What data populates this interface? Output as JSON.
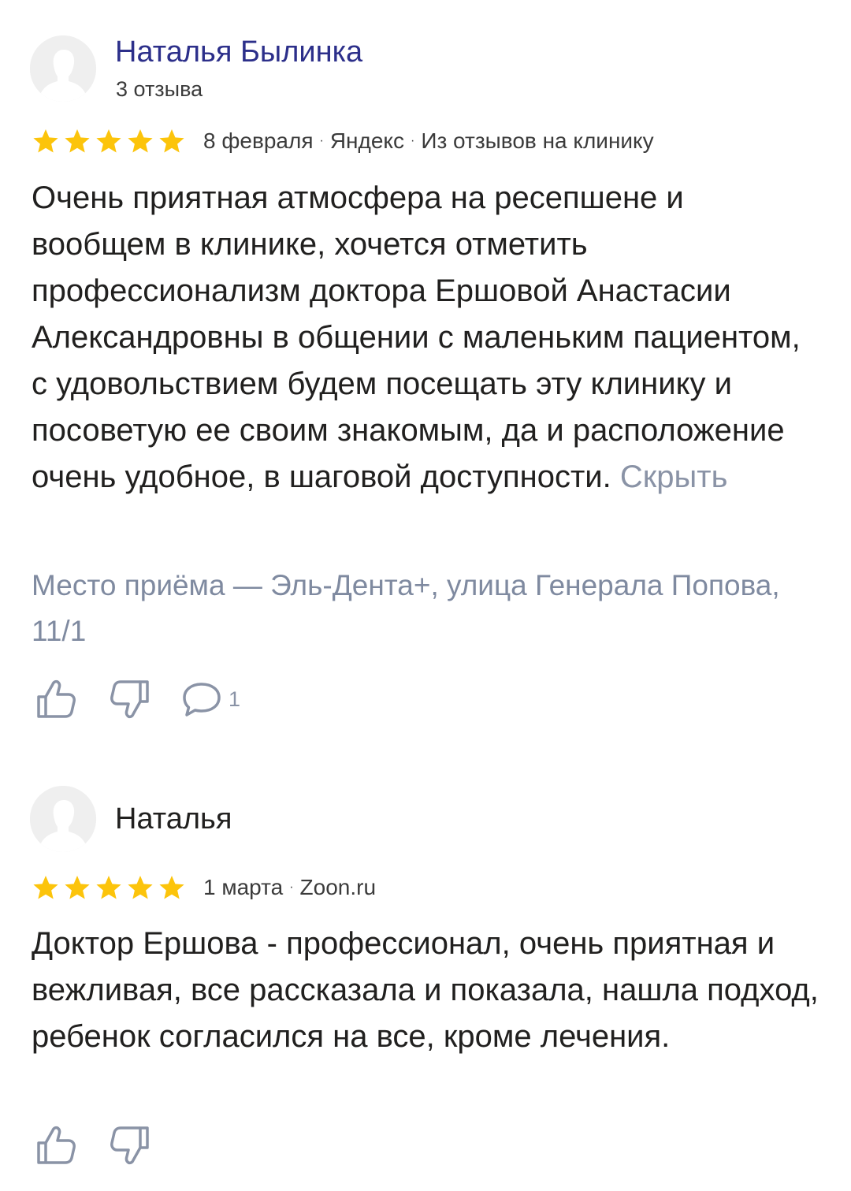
{
  "reviews": [
    {
      "author": "Наталья Былинка",
      "author_sub": "3 отзыва",
      "rating": 5,
      "date": "8 февраля",
      "source": "Яндекс",
      "origin": "Из отзывов на клинику",
      "text": "Очень приятная атмосфера на ресепшене и вообщем в клинике, хочется отметить профессионализм доктора Ершовой Анастасии Александровны в общении с маленьким пациентом, с удовольствием будем посещать эту клинику и посоветую ее своим знакомым, да и расположение очень удобное, в шаговой доступности.",
      "toggle_label": "Скрыть",
      "place": "Место приёма — Эль-Дента+, улица Генерала Попова, 11/1",
      "comments_count": "1"
    },
    {
      "author": "Наталья",
      "rating": 5,
      "date": "1 марта",
      "source": "Zoon.ru",
      "text": "Доктор Ершова - профессионал, очень приятная и вежливая, все рассказала и показала, нашла подход, ребенок согласился на все, кроме лечения."
    }
  ],
  "meta_separator": "·",
  "colors": {
    "star": "#fcc40b",
    "author_link": "#2c2f8a",
    "muted": "#8a93a6",
    "text": "#21201f"
  },
  "icons": [
    "user-avatar-icon",
    "star-icon",
    "thumbs-up-icon",
    "thumbs-down-icon",
    "comment-icon"
  ]
}
